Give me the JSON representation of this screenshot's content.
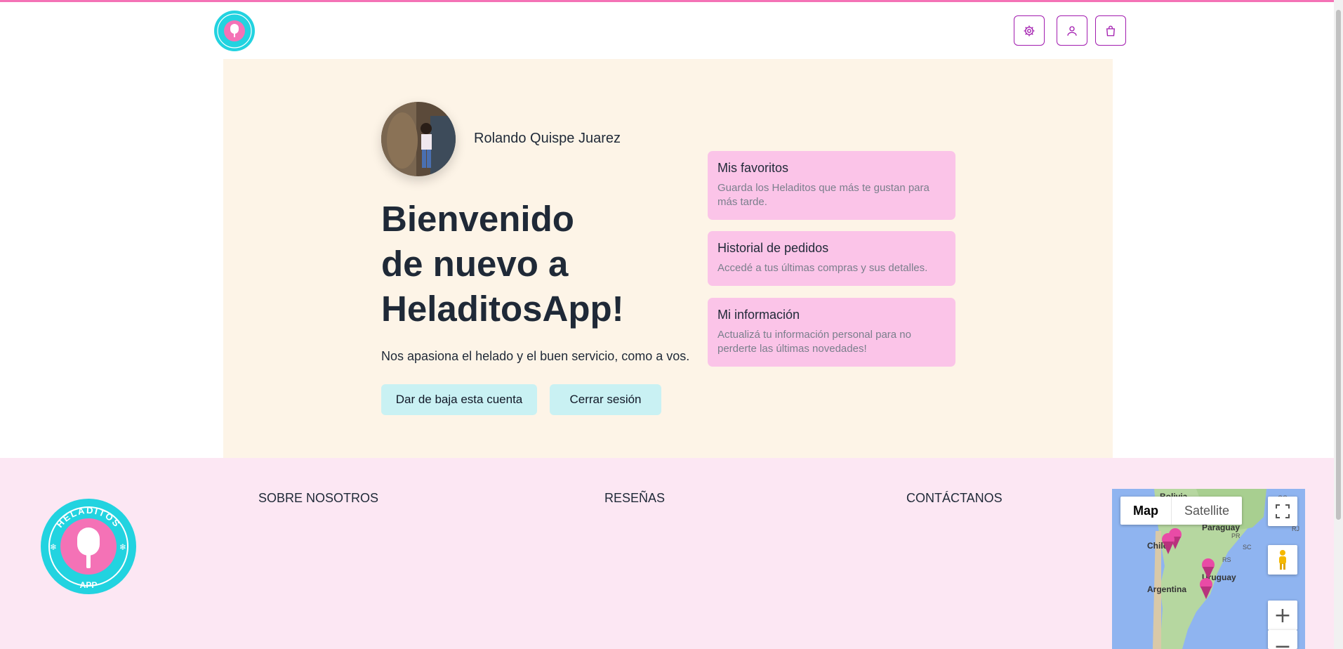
{
  "header": {
    "logo_alt": "HeladitosApp logo",
    "icons": [
      "gear-icon",
      "user-icon",
      "shopping-bag-icon"
    ]
  },
  "profile": {
    "name": "Rolando Quispe Juarez"
  },
  "hero": {
    "welcome_line1": "Bienvenido",
    "welcome_line2": "de nuevo a",
    "welcome_line3": "HeladitosApp!",
    "tagline": "Nos apasiona el helado y el buen servicio, como a vos.",
    "delete_account": "Dar de baja esta cuenta",
    "logout": "Cerrar sesión"
  },
  "cards": [
    {
      "title": "Mis favoritos",
      "desc": "Guarda los Heladitos que más te gustan para más tarde."
    },
    {
      "title": "Historial de pedidos",
      "desc": "Accedé a tus últimas compras y sus detalles."
    },
    {
      "title": "Mi información",
      "desc": "Actualizá tu información personal para no perderte las últimas novedades!"
    }
  ],
  "footer": {
    "links": [
      "SOBRE NOSOTROS",
      "RESEÑAS",
      "CONTÁCTANOS"
    ],
    "logo_text_top": "HELADITOS",
    "logo_text_bottom": "APP"
  },
  "map": {
    "tab_map": "Map",
    "tab_satellite": "Satellite",
    "labels": [
      "Bolivia",
      "Paraguay",
      "Chile",
      "Uruguay",
      "Argentina",
      "PR",
      "SC",
      "RS",
      "GO",
      "RJ"
    ],
    "zoom_in": "+",
    "zoom_out": "−"
  },
  "colors": {
    "accent_pink": "#f472b6",
    "hero_bg": "#fdf4e7",
    "card_bg": "#fbc4e8",
    "button_bg": "#c9f1f3",
    "footer_bg": "#fce7f3",
    "logo_cyan": "#22d3e0",
    "icon_border": "#a21caf"
  }
}
